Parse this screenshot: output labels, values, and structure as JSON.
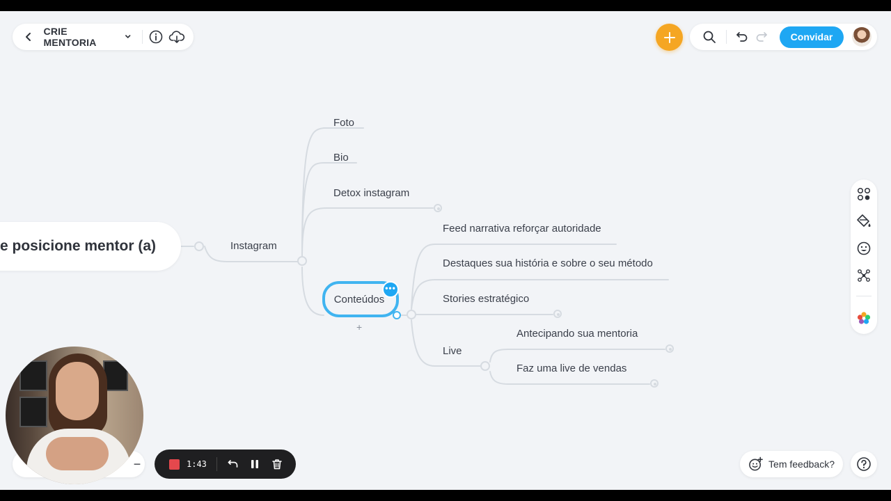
{
  "toolbar_left": {
    "title": "CRIE MENTORIA"
  },
  "toolbar_right": {
    "invite_label": "Convidar"
  },
  "mindmap": {
    "root": "e posicione mentor (a)",
    "instagram": "Instagram",
    "foto": "Foto",
    "bio": "Bio",
    "detox": "Detox instagram",
    "conteudos": "Conteúdos",
    "add_symbol": "+",
    "feed": "Feed narrativa reforçar autoridade",
    "destaques": "Destaques sua história e sobre o seu método",
    "stories": "Stories estratégico",
    "live": "Live",
    "antecipando": "Antecipando sua mentoria",
    "faz_live": "Faz uma live de vendas"
  },
  "recorder": {
    "time": "1:43"
  },
  "zoom": {
    "minus": "−"
  },
  "feedback": {
    "label": "Tem feedback?"
  },
  "icons": [
    "back-icon",
    "chevron-down-icon",
    "info-icon",
    "cloud-download-icon",
    "plus-icon",
    "search-icon",
    "undo-icon",
    "redo-icon",
    "avatar",
    "layout-icon",
    "paint-bucket-icon",
    "emoji-icon",
    "network-icon",
    "color-palette-icon",
    "stop-icon",
    "pause-icon",
    "trash-icon",
    "feedback-icon",
    "help-icon"
  ],
  "colors": {
    "accent": "#1ea7f3",
    "add_button": "#f5a623",
    "stop": "#e5484d",
    "selection": "#40b4f0",
    "connector": "#d6dbe1",
    "canvas": "#f2f4f7"
  }
}
